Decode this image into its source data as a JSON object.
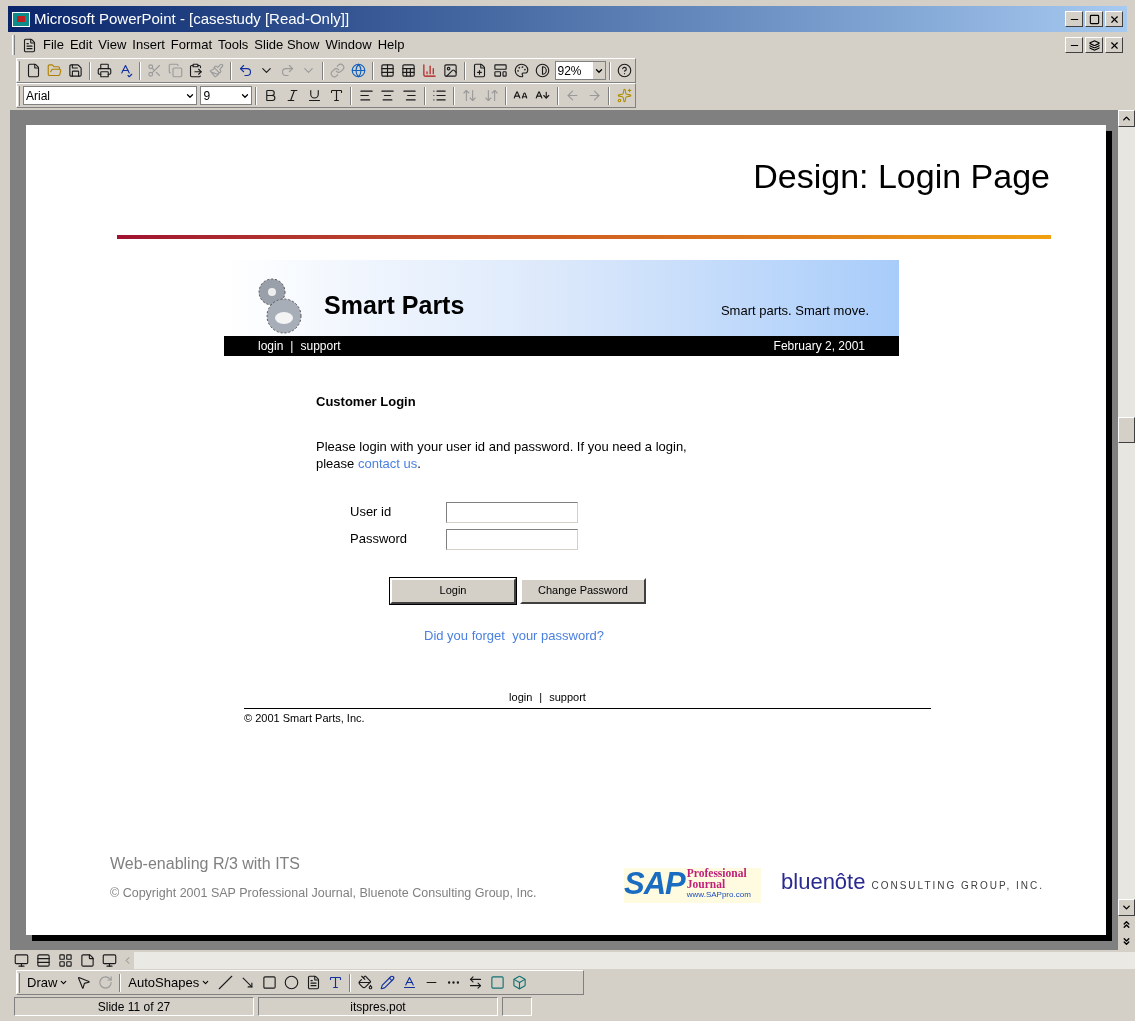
{
  "window": {
    "title": "Microsoft PowerPoint - [casestudy [Read-Only]]"
  },
  "menu": [
    "File",
    "Edit",
    "View",
    "Insert",
    "Format",
    "Tools",
    "Slide Show",
    "Window",
    "Help"
  ],
  "toolbar": {
    "zoom": "92%",
    "font": "Arial",
    "font_size": "9"
  },
  "slide": {
    "title": "Design: Login Page",
    "web_page": {
      "brand": "Smart Parts",
      "tagline": "Smart parts. Smart move.",
      "nav_links": [
        "login",
        "support"
      ],
      "separator": "|",
      "date": "February 2, 2001",
      "heading": "Customer Login",
      "intro_before": "Please login with your user id and password. If you need a login, please ",
      "intro_link": "contact us",
      "intro_after": ".",
      "fields": [
        {
          "label": "User id"
        },
        {
          "label": "Password"
        }
      ],
      "buttons": [
        "Login",
        "Change Password"
      ],
      "forgot_link": "Did you forget  your password?",
      "footer_links": [
        "login",
        "support"
      ],
      "footer_separator": "|",
      "copyright": "© 2001 Smart Parts, Inc."
    },
    "footer_title": "Web-enabling R/3 with ITS",
    "footer_copyright": "© Copyright 2001 SAP Professional Journal, Bluenote Consulting Group, Inc.",
    "sap_logo": {
      "mark": "SAP",
      "line1": "Professional",
      "line2": "Journal",
      "url": "www.SAPpro.com"
    },
    "bluenote_logo": {
      "name": "bluenôte",
      "tagline": "CONSULTING GROUP, INC."
    }
  },
  "draw_toolbar": {
    "draw": "Draw",
    "autoshapes": "AutoShapes"
  },
  "status_bar": [
    "Slide 11 of 27",
    "itspres.pot"
  ]
}
